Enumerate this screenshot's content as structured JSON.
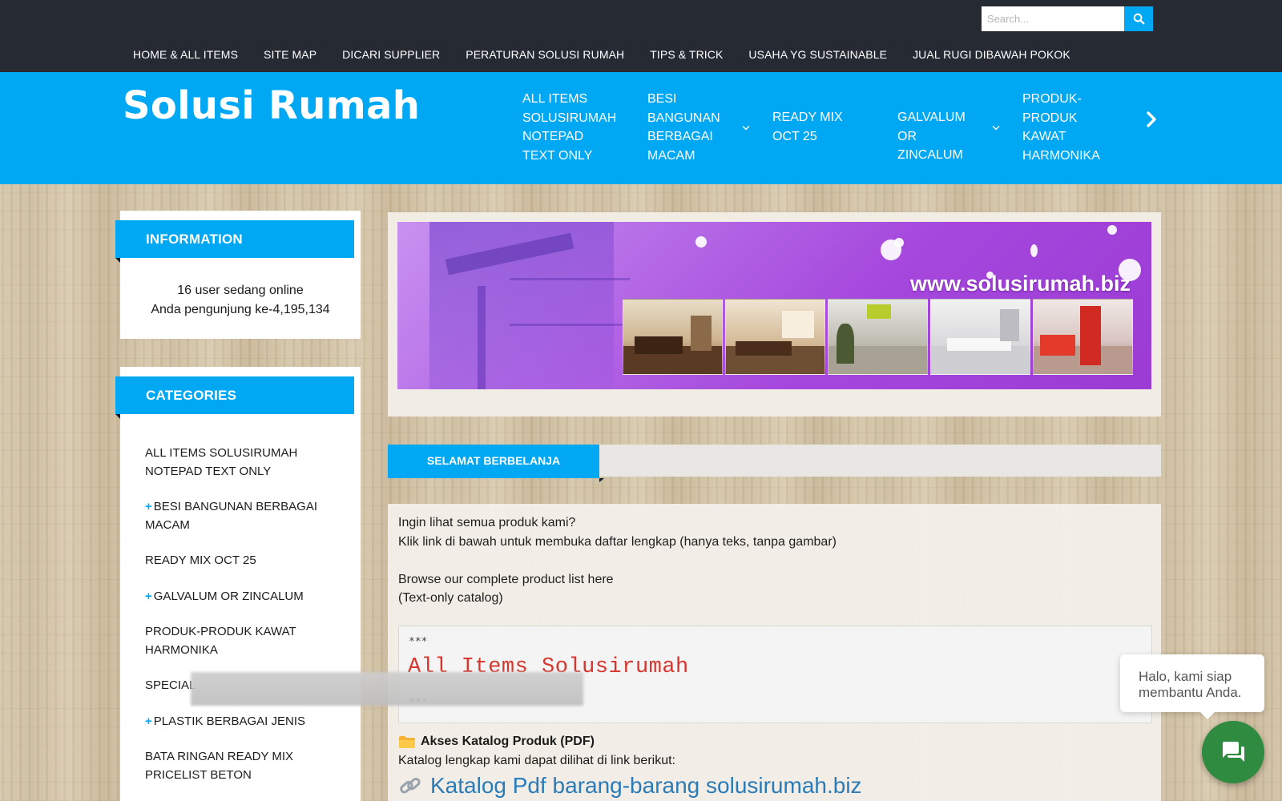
{
  "search": {
    "placeholder": "Search..."
  },
  "topnav": [
    "HOME & ALL ITEMS",
    "SITE MAP",
    "DICARI SUPPLIER",
    "PERATURAN SOLUSI RUMAH",
    "TIPS & TRICK",
    "USAHA YG SUSTAINABLE",
    "JUAL RUGI DIBAWAH POKOK"
  ],
  "brand": {
    "logo": "Solusi Rumah"
  },
  "mainnav": [
    {
      "label": "ALL ITEMS SOLUSIRUMAH NOTEPAD TEXT ONLY",
      "dropdown": false
    },
    {
      "label": "BESI BANGUNAN BERBAGAI MACAM",
      "dropdown": true
    },
    {
      "label": "READY MIX OCT 25",
      "dropdown": false
    },
    {
      "label": "GALVALUM OR ZINCALUM",
      "dropdown": true
    },
    {
      "label": "PRODUK-PRODUK KAWAT HARMONIKA",
      "dropdown": false
    }
  ],
  "info": {
    "title": "INFORMATION",
    "online": "16 user sedang online",
    "visitor": "Anda pengunjung ke-4,195,134"
  },
  "categories": {
    "title": "CATEGORIES",
    "items": [
      {
        "label": "ALL ITEMS SOLUSIRUMAH NOTEPAD TEXT ONLY",
        "plus": false
      },
      {
        "label": "BESI BANGUNAN BERBAGAI MACAM",
        "plus": true
      },
      {
        "label": "READY MIX OCT 25",
        "plus": false
      },
      {
        "label": "GALVALUM OR ZINCALUM",
        "plus": true
      },
      {
        "label": "PRODUK-PRODUK KAWAT HARMONIKA",
        "plus": false
      },
      {
        "label": "SPECIAL",
        "plus": false
      },
      {
        "label": "PLASTIK BERBAGAI JENIS",
        "plus": true
      },
      {
        "label": "BATA RINGAN READY MIX PRICELIST BETON",
        "plus": false
      }
    ]
  },
  "banner": {
    "url": "www.solusirumah.biz"
  },
  "tab": {
    "label": "SELAMAT BERBELANJA"
  },
  "content": {
    "line1": "Ingin lihat semua produk kami?",
    "line2": "Klik link di bawah untuk membuka daftar lengkap (hanya teks, tanpa gambar)",
    "line3": "Browse our complete product list here",
    "line4": "(Text-only catalog)",
    "code_stars_top": "***",
    "code_title": "All Items Solusirumah",
    "code_stars_bottom": "***",
    "catalog_heading": "Akses Katalog Produk (PDF)",
    "catalog_text": "Katalog lengkap kami dapat dilihat di link berikut:",
    "catalog_link": "Katalog Pdf barang-barang solusirumah.biz"
  },
  "chat": {
    "bubble": "Halo, kami siap membantu Anda."
  },
  "colors": {
    "accent": "#00a8f3",
    "topbar": "#262a33",
    "chat": "#2e8b3f",
    "code_title": "#d6362d",
    "link": "#2a7bb8"
  },
  "icons": {
    "search": "search-icon",
    "next": "chevron-right-icon",
    "dropdown": "chevron-down-icon",
    "folder": "folder-icon",
    "link": "link-icon",
    "chat": "chat-icon"
  }
}
